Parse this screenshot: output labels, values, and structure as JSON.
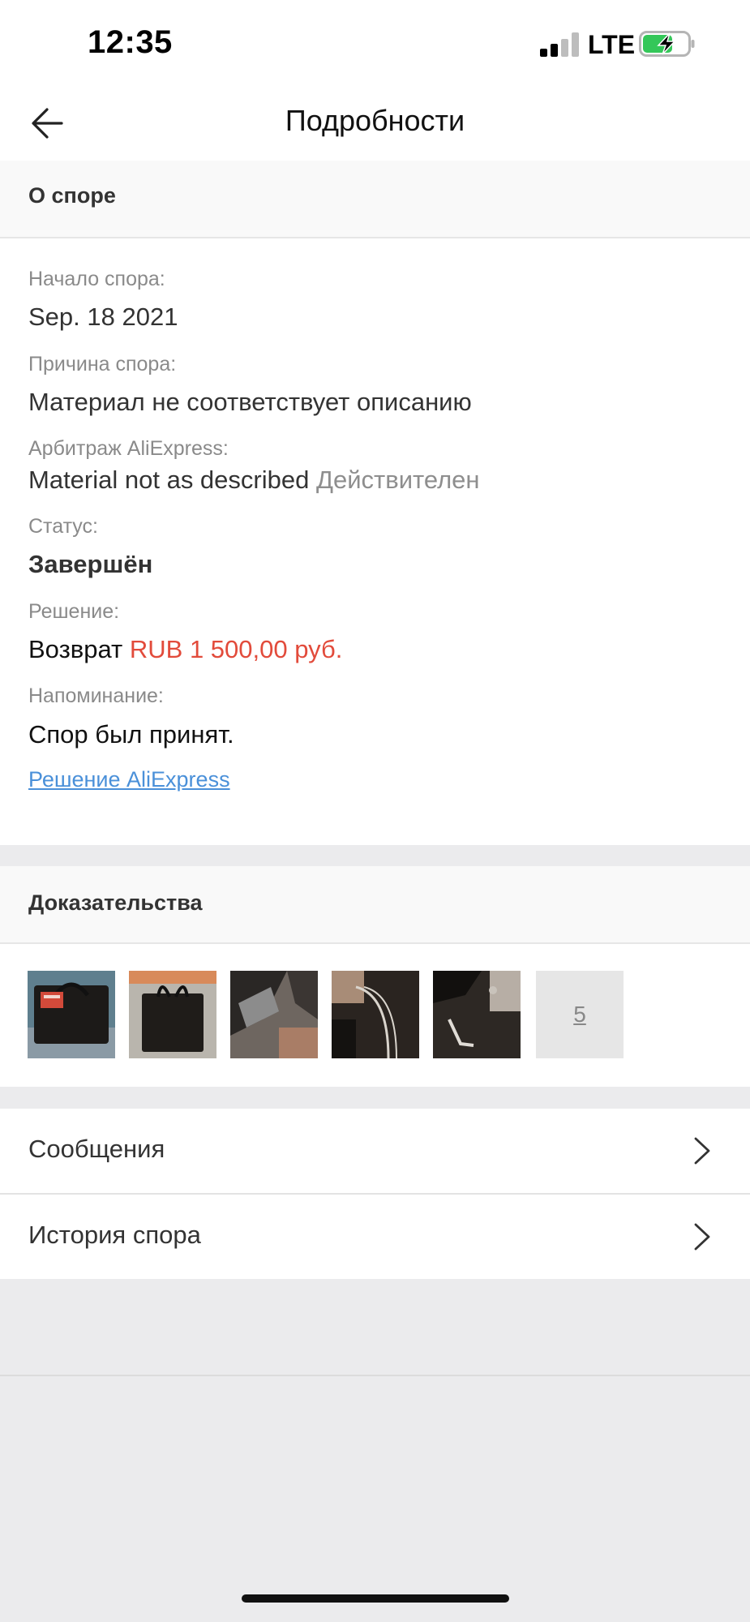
{
  "status_bar": {
    "time": "12:35",
    "network": "LTE"
  },
  "header": {
    "title": "Подробности"
  },
  "dispute": {
    "section_title": "О споре",
    "start_label": "Начало спора:",
    "start_value": "Sep. 18 2021",
    "reason_label": "Причина спора:",
    "reason_value": "Материал не соответствует описанию",
    "arbitration_label": "Арбитраж AliExpress:",
    "arbitration_value": "Material not as described",
    "arbitration_status": "Действителен",
    "status_label": "Статус:",
    "status_value": "Завершён",
    "resolution_label": "Решение:",
    "resolution_prefix": "Возврат",
    "resolution_amount": "RUB 1 500,00 руб.",
    "reminder_label": "Напоминание:",
    "reminder_value": "Спор был принят.",
    "decision_link": "Решение AliExpress"
  },
  "evidence": {
    "section_title": "Доказательства",
    "more_count": "5"
  },
  "menu": {
    "messages": "Сообщения",
    "history": "История спора"
  },
  "colors": {
    "accent_red": "#e24b3b",
    "link_blue": "#4a90d9",
    "battery_green": "#34c759"
  }
}
